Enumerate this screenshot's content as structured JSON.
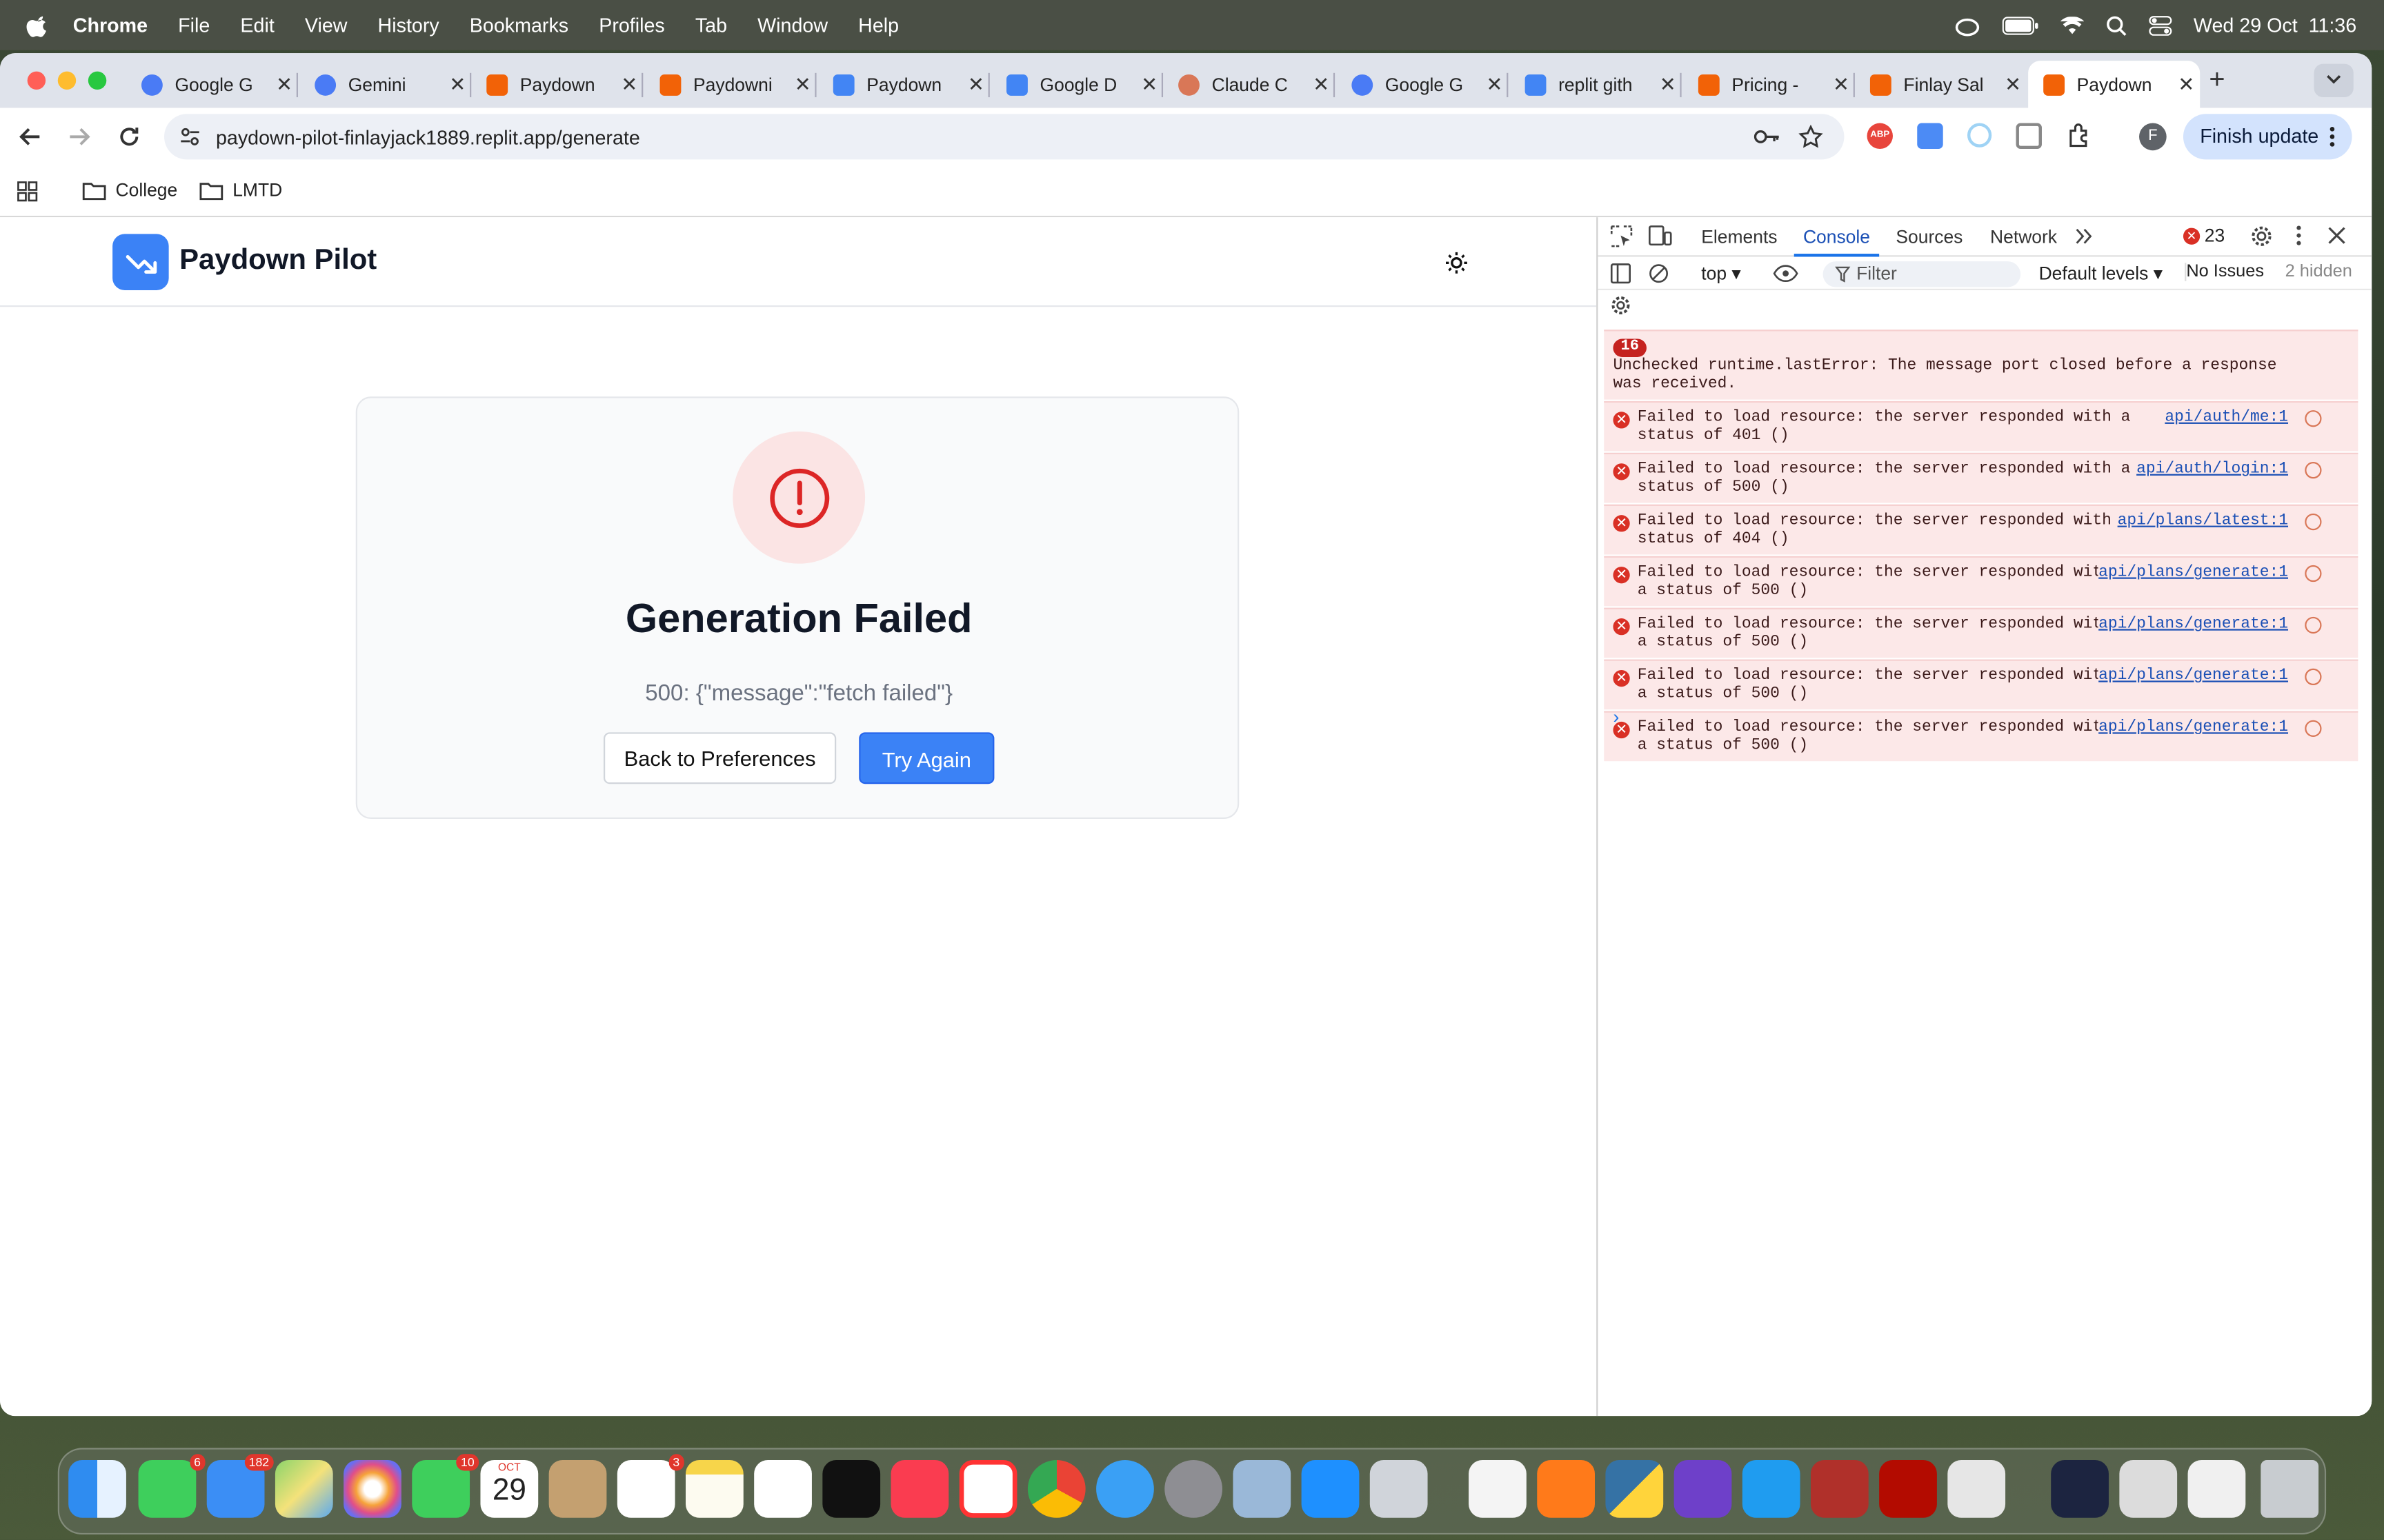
{
  "menubar": {
    "app_name": "Chrome",
    "menus": [
      "File",
      "Edit",
      "View",
      "History",
      "Bookmarks",
      "Profiles",
      "Tab",
      "Window",
      "Help"
    ],
    "datetime": "Wed 29 Oct  11:36"
  },
  "tabs": [
    {
      "label": "Google G",
      "icon": "gemini-icon"
    },
    {
      "label": "Gemini",
      "icon": "gemini-icon"
    },
    {
      "label": "Paydown",
      "icon": "replit-icon"
    },
    {
      "label": "Paydowni",
      "icon": "replit-icon"
    },
    {
      "label": "Paydown",
      "icon": "docs-icon"
    },
    {
      "label": "Google D",
      "icon": "docs-icon"
    },
    {
      "label": "Claude C",
      "icon": "claude-icon"
    },
    {
      "label": "Google G",
      "icon": "gemini-icon"
    },
    {
      "label": "replit gith",
      "icon": "google-icon"
    },
    {
      "label": "Pricing - ",
      "icon": "replit-icon"
    },
    {
      "label": "Finlay Sal",
      "icon": "replit-icon"
    },
    {
      "label": "Paydown",
      "icon": "replit-icon"
    }
  ],
  "toolbar": {
    "url": "paydown-pilot-finlayjack1889.replit.app/generate",
    "finish_update": "Finish update",
    "profile_initial": "F"
  },
  "bookmarks": [
    "College",
    "LMTD"
  ],
  "app": {
    "brand": "Paydown Pilot",
    "card": {
      "title": "Generation Failed",
      "message": "500: {\"message\":\"fetch failed\"}",
      "back_button": "Back to Preferences",
      "retry_button": "Try Again"
    }
  },
  "devtools": {
    "tabs": [
      "Elements",
      "Console",
      "Sources",
      "Network"
    ],
    "active_tab": "Console",
    "error_count": "23",
    "context": "top",
    "filter_placeholder": "Filter",
    "levels": "Default levels",
    "issues": "No Issues",
    "hidden": "2 hidden",
    "logs": [
      {
        "badge": "16",
        "text": "Unchecked runtime.lastError: The message port closed before a response\nwas received.",
        "source": ""
      },
      {
        "badge": "",
        "text": "Failed to load resource: the server responded with a\nstatus of 401 ()",
        "source": "api/auth/me:1"
      },
      {
        "badge": "",
        "text": "Failed to load resource: the server responded with a\nstatus of 500 ()",
        "source": "api/auth/login:1"
      },
      {
        "badge": "",
        "text": "Failed to load resource: the server responded with a\nstatus of 404 ()",
        "source": "api/plans/latest:1"
      },
      {
        "badge": "",
        "text": "Failed to load resource: the server responded with\na status of 500 ()",
        "source": "api/plans/generate:1"
      },
      {
        "badge": "",
        "text": "Failed to load resource: the server responded with\na status of 500 ()",
        "source": "api/plans/generate:1"
      },
      {
        "badge": "",
        "text": "Failed to load resource: the server responded with\na status of 500 ()",
        "source": "api/plans/generate:1"
      },
      {
        "badge": "",
        "text": "Failed to load resource: the server responded with\na status of 500 ()",
        "source": "api/plans/generate:1"
      }
    ]
  },
  "dock": {
    "badges": {
      "messages": "6",
      "mail": "182",
      "facetime": "10",
      "reminders": "3"
    },
    "calendar_month": "OCT",
    "calendar_day": "29"
  },
  "colors": {
    "accent": "#3b82f6",
    "error": "#d93025",
    "error_bg": "#fce8e8"
  }
}
